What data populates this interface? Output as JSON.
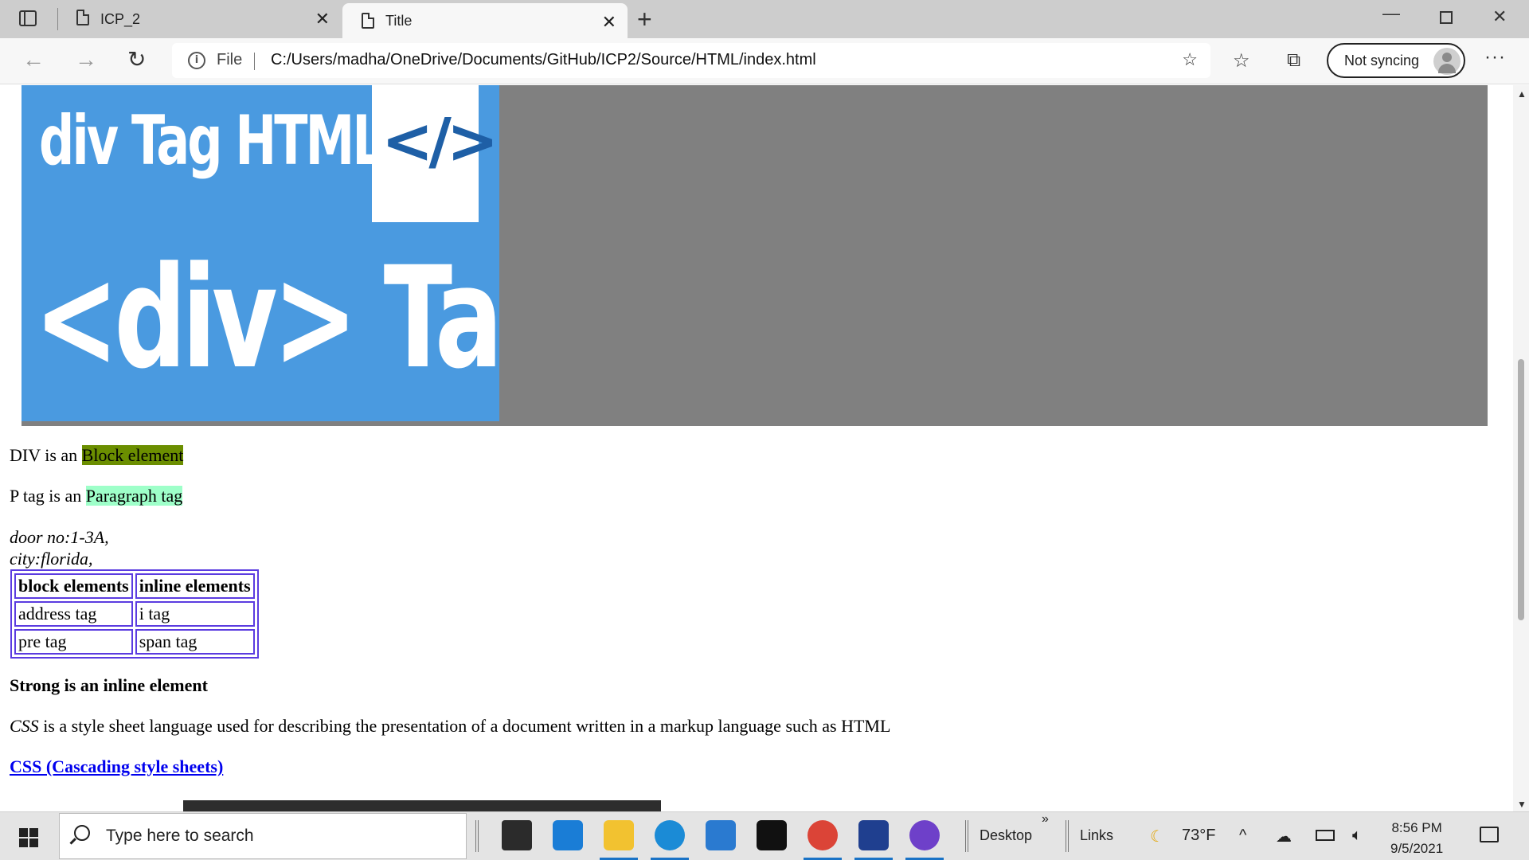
{
  "browser": {
    "tabs": [
      {
        "title": "ICP_2"
      },
      {
        "title": "Title"
      }
    ],
    "address": {
      "scheme_label": "File",
      "url": "C:/Users/madha/OneDrive/Documents/GitHub/ICP2/Source/HTML/index.html"
    },
    "sync_label": "Not syncing"
  },
  "page": {
    "image_text_line1": "div Tag HTML",
    "image_code_glyph": "</>",
    "image_text_line2": "<div> Tag",
    "div_line_prefix": "DIV is an ",
    "div_line_highlight": "Block element",
    "p_line_prefix": "P tag is an ",
    "p_line_highlight": "Paragraph tag",
    "address_line1": "door no:1-3A,",
    "address_line2": "city:florida,",
    "table": {
      "headers": [
        "block elements",
        "inline elements"
      ],
      "rows": [
        [
          "address tag",
          "i tag"
        ],
        [
          "pre tag",
          "span tag"
        ]
      ]
    },
    "strong_text": "Strong is an inline element",
    "css_em": "CSS",
    "css_rest": " is a style sheet language used for describing the presentation of a document written in a markup language such as HTML",
    "link_text": "CSS (Cascading style sheets)"
  },
  "taskbar": {
    "search_placeholder": "Type here to search",
    "desktop_label": "Desktop",
    "links_label": "Links",
    "weather": "73°F",
    "time": "8:56 PM",
    "date": "9/5/2021"
  },
  "colors": {
    "block_highlight": "#6b8e00",
    "paragraph_highlight": "#9effc9",
    "table_border": "#5b3ce0",
    "link": "#0000ee"
  }
}
